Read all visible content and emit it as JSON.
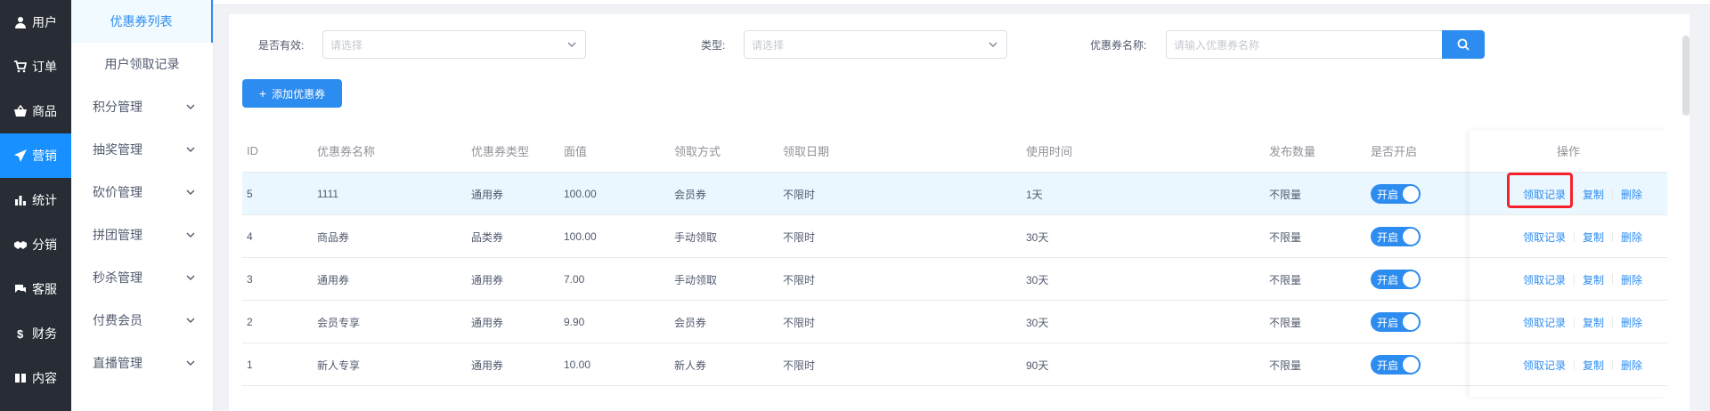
{
  "nav": {
    "items": [
      {
        "label": "用户",
        "icon": "user-icon"
      },
      {
        "label": "订单",
        "icon": "cart-icon"
      },
      {
        "label": "商品",
        "icon": "basket-icon"
      },
      {
        "label": "营销",
        "icon": "send-icon",
        "active": true
      },
      {
        "label": "统计",
        "icon": "bar-chart-icon"
      },
      {
        "label": "分销",
        "icon": "handshake-icon"
      },
      {
        "label": "客服",
        "icon": "chat-icon"
      },
      {
        "label": "财务",
        "icon": "dollar-icon"
      },
      {
        "label": "内容",
        "icon": "book-icon"
      }
    ]
  },
  "submenu": {
    "items": [
      {
        "label": "优惠券列表",
        "active": true
      },
      {
        "label": "用户领取记录"
      }
    ],
    "groups": [
      "积分管理",
      "抽奖管理",
      "砍价管理",
      "拼团管理",
      "秒杀管理",
      "付费会员",
      "直播管理"
    ]
  },
  "filters": {
    "valid_label": "是否有效:",
    "valid_placeholder": "请选择",
    "type_label": "类型:",
    "type_placeholder": "请选择",
    "name_label": "优惠券名称:",
    "name_placeholder": "请输入优惠券名称"
  },
  "toolbar": {
    "add_label": "添加优惠券",
    "add_icon": "+"
  },
  "table": {
    "headers": [
      "ID",
      "优惠券名称",
      "优惠券类型",
      "面值",
      "领取方式",
      "领取日期",
      "使用时间",
      "发布数量",
      "是否开启",
      "操作"
    ],
    "rows": [
      {
        "id": "5",
        "name": "1111",
        "type": "通用券",
        "value": "100.00",
        "method": "会员券",
        "date": "不限时",
        "time": "1天",
        "qty": "不限量",
        "switch": "开启"
      },
      {
        "id": "4",
        "name": "商品券",
        "type": "品类券",
        "value": "100.00",
        "method": "手动领取",
        "date": "不限时",
        "time": "30天",
        "qty": "不限量",
        "switch": "开启"
      },
      {
        "id": "3",
        "name": "通用券",
        "type": "通用券",
        "value": "7.00",
        "method": "手动领取",
        "date": "不限时",
        "time": "30天",
        "qty": "不限量",
        "switch": "开启"
      },
      {
        "id": "2",
        "name": "会员专享",
        "type": "通用券",
        "value": "9.90",
        "method": "会员券",
        "date": "不限时",
        "time": "30天",
        "qty": "不限量",
        "switch": "开启"
      },
      {
        "id": "1",
        "name": "新人专享",
        "type": "通用券",
        "value": "10.00",
        "method": "新人券",
        "date": "不限时",
        "time": "90天",
        "qty": "不限量",
        "switch": "开启"
      }
    ],
    "actions": [
      "领取记录",
      "复制",
      "删除"
    ]
  },
  "colors": {
    "primary": "#2d8cf0",
    "nav_bg": "#282c34",
    "nav_active": "#1890ff",
    "highlight": "#f5222d"
  }
}
